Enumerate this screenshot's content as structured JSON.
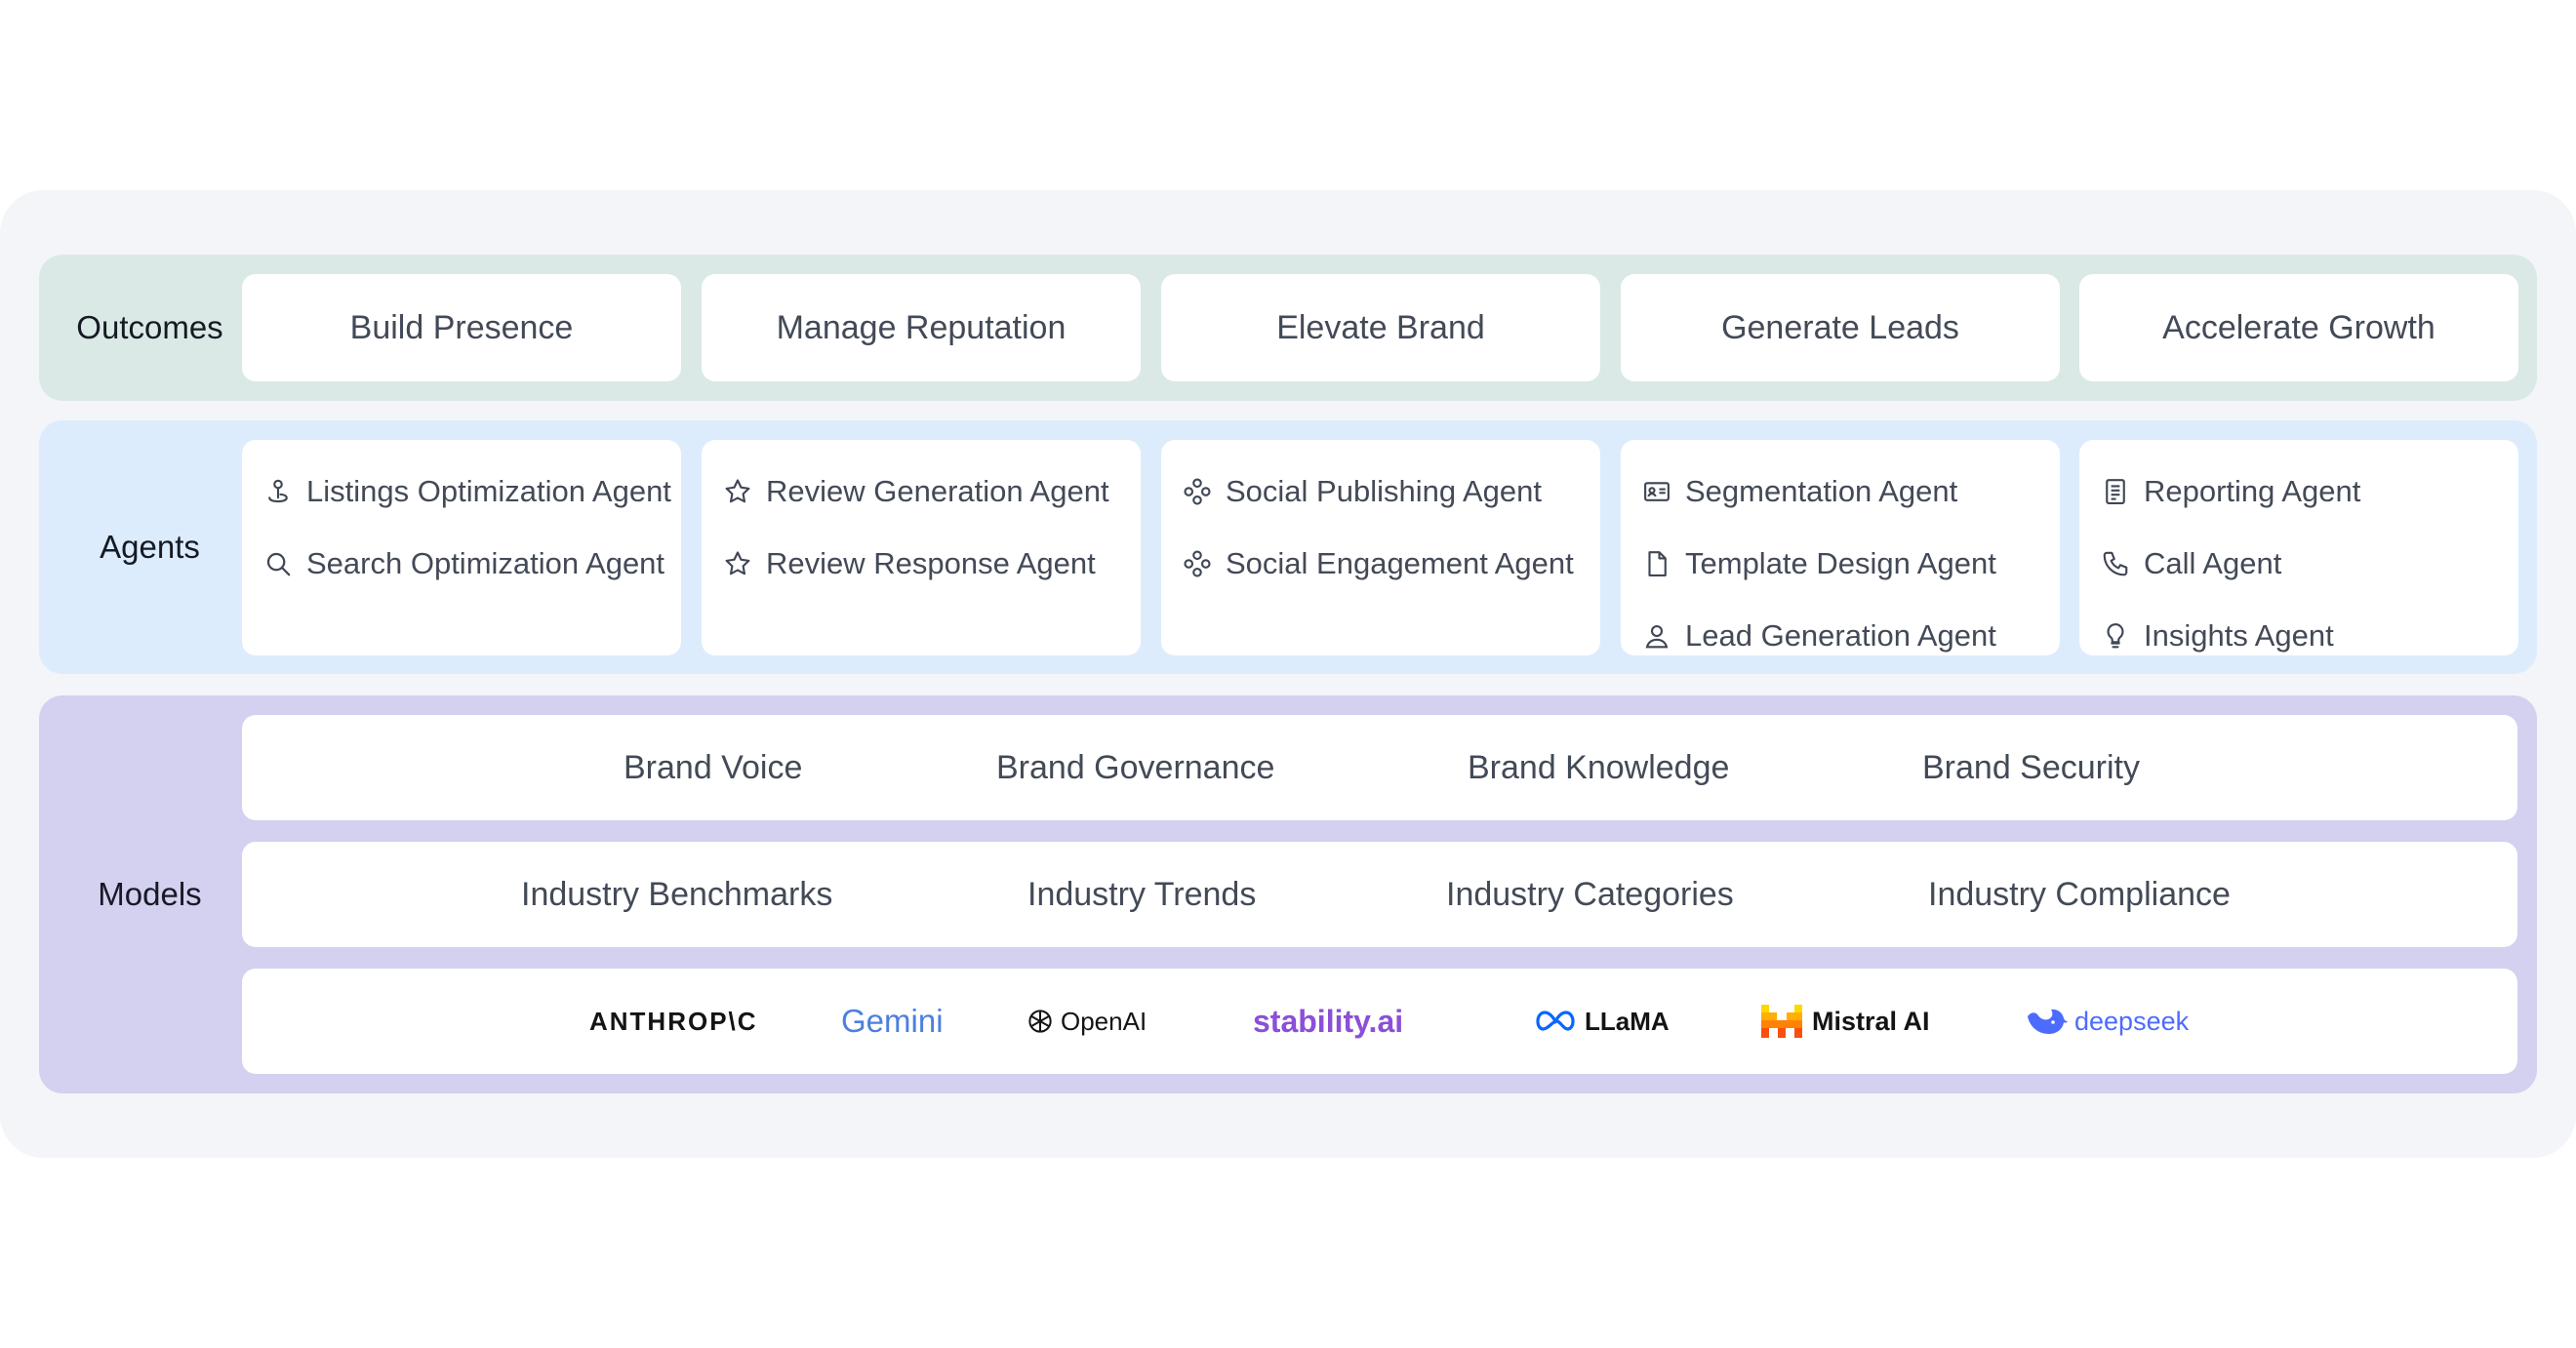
{
  "outcomes": {
    "label": "Outcomes",
    "items": [
      "Build Presence",
      "Manage Reputation",
      "Elevate Brand",
      "Generate Leads",
      "Accelerate Growth"
    ]
  },
  "agents": {
    "label": "Agents",
    "columns": [
      [
        {
          "label": "Listings Optimization Agent",
          "icon": "map-pin-icon"
        },
        {
          "label": "Search Optimization Agent",
          "icon": "search-icon"
        }
      ],
      [
        {
          "label": "Review Generation Agent",
          "icon": "star-icon"
        },
        {
          "label": "Review Response Agent",
          "icon": "star-icon"
        }
      ],
      [
        {
          "label": "Social Publishing Agent",
          "icon": "network-icon"
        },
        {
          "label": "Social Engagement Agent",
          "icon": "network-icon"
        }
      ],
      [
        {
          "label": "Segmentation Agent",
          "icon": "id-card-icon"
        },
        {
          "label": "Template Design Agent",
          "icon": "document-icon"
        },
        {
          "label": "Lead Generation Agent",
          "icon": "user-icon"
        }
      ],
      [
        {
          "label": "Reporting Agent",
          "icon": "report-icon"
        },
        {
          "label": "Call Agent",
          "icon": "phone-icon"
        },
        {
          "label": "Insights Agent",
          "icon": "lightbulb-icon"
        }
      ]
    ]
  },
  "models": {
    "label": "Models",
    "brand": [
      "Brand Voice",
      "Brand Governance",
      "Brand Knowledge",
      "Brand Security"
    ],
    "industry": [
      "Industry Benchmarks",
      "Industry Trends",
      "Industry Categories",
      "Industry Compliance"
    ],
    "providers": [
      "ANTHROP\\C",
      "Gemini",
      "OpenAI",
      "stability.ai",
      "LLaMA",
      "Mistral AI",
      "deepseek"
    ]
  },
  "colors": {
    "outcomes_band": "#dbe9e6",
    "agents_band": "#dcecfd",
    "models_band": "#d3d0f0",
    "stability": "#8b4fd8",
    "deepseek": "#4d6bfe",
    "mistral": "#f7541f"
  }
}
